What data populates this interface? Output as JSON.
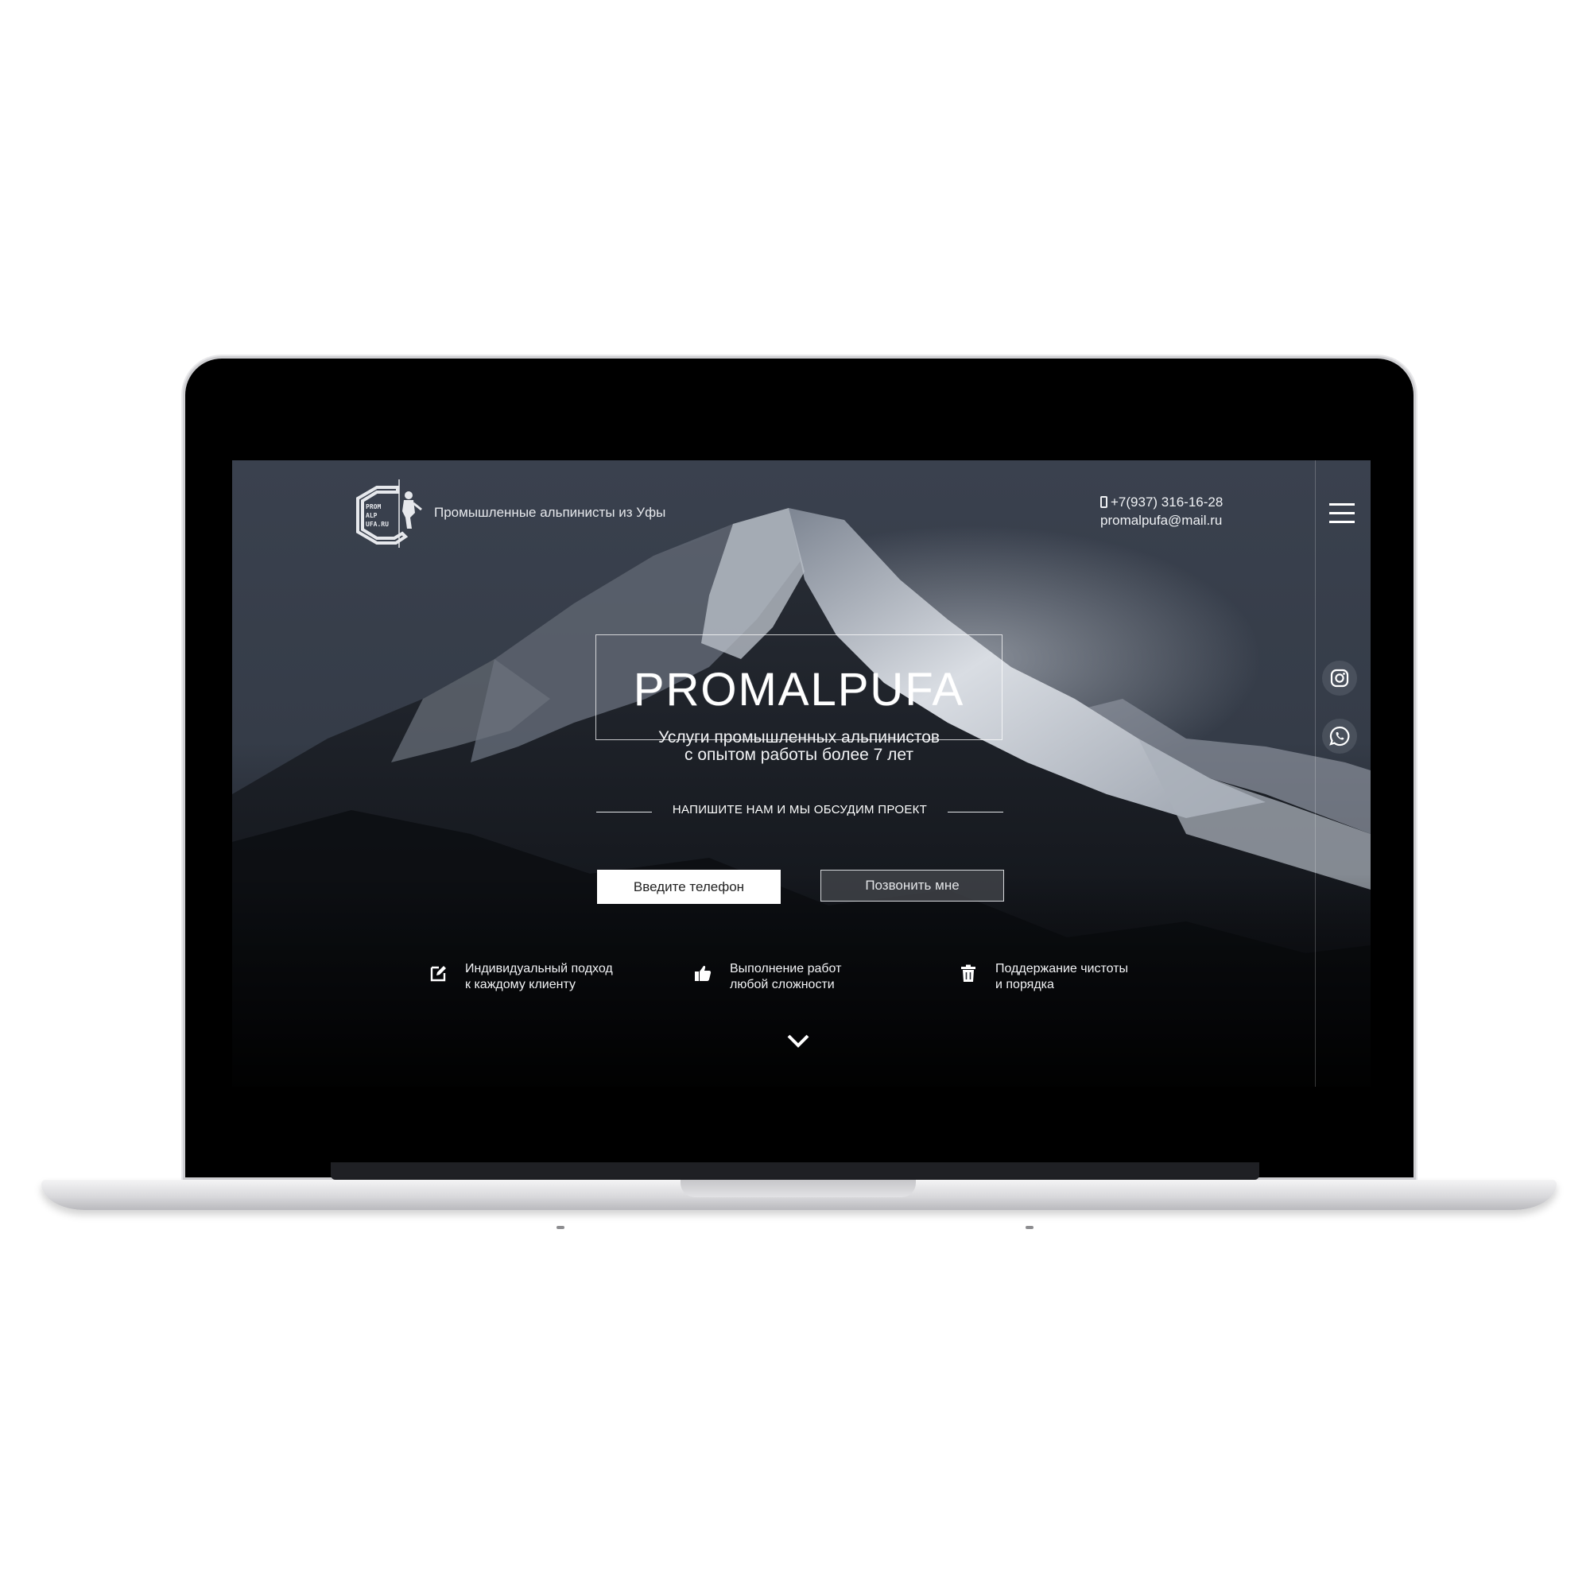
{
  "header": {
    "logo_text": [
      "PROM",
      "ALP",
      "UFA.RU"
    ],
    "tagline": "Промышленные альпинисты из Уфы",
    "phone": "+7(937) 316-16-28",
    "email": "promalpufa@mail.ru"
  },
  "hero": {
    "brand": "PROMALPUFA",
    "subtitle_line1": "Услуги промышленных альпинистов",
    "subtitle_line2": "с опытом работы более 7 лет",
    "call_to_action": "НАПИШИТЕ НАМ И МЫ ОБСУДИМ ПРОЕКТ",
    "phone_placeholder": "Введите телефон",
    "call_button": "Позвонить мне"
  },
  "features": [
    {
      "line1": "Индивидуальный подход",
      "line2": "к каждому клиенту",
      "icon": "edit-icon"
    },
    {
      "line1": "Выполнение работ",
      "line2": "любой сложности",
      "icon": "thumbs-up-icon"
    },
    {
      "line1": "Поддержание чистоты",
      "line2": "и порядка",
      "icon": "trash-icon"
    }
  ],
  "social": [
    {
      "icon": "instagram-icon"
    },
    {
      "icon": "whatsapp-icon"
    }
  ]
}
